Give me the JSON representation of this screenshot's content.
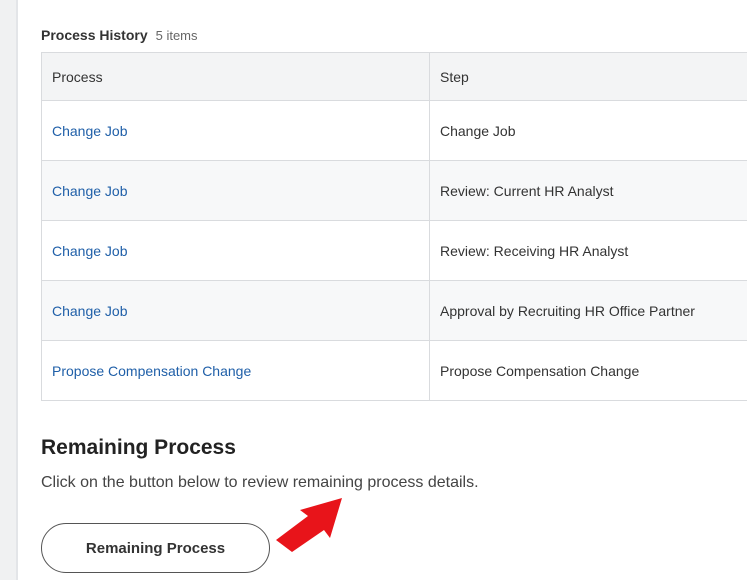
{
  "process_history": {
    "title": "Process History",
    "count": "5 items",
    "columns": {
      "process": "Process",
      "step": "Step"
    },
    "rows": [
      {
        "process": "Change Job",
        "step": "Change Job"
      },
      {
        "process": "Change Job",
        "step": "Review: Current HR Analyst"
      },
      {
        "process": "Change Job",
        "step": "Review: Receiving HR Analyst"
      },
      {
        "process": "Change Job",
        "step": "Approval by Recruiting HR Office Partner"
      },
      {
        "process": "Propose Compensation Change",
        "step": "Propose Compensation Change"
      }
    ]
  },
  "remaining": {
    "title": "Remaining Process",
    "description": "Click on the button below to review remaining process details.",
    "button_label": "Remaining Process"
  },
  "colors": {
    "link": "#1f5fa8",
    "arrow": "#e8141a",
    "header_bg": "#f3f4f5",
    "border": "#d9dbde"
  },
  "icons": {
    "pointer": "red-arrow-icon"
  }
}
